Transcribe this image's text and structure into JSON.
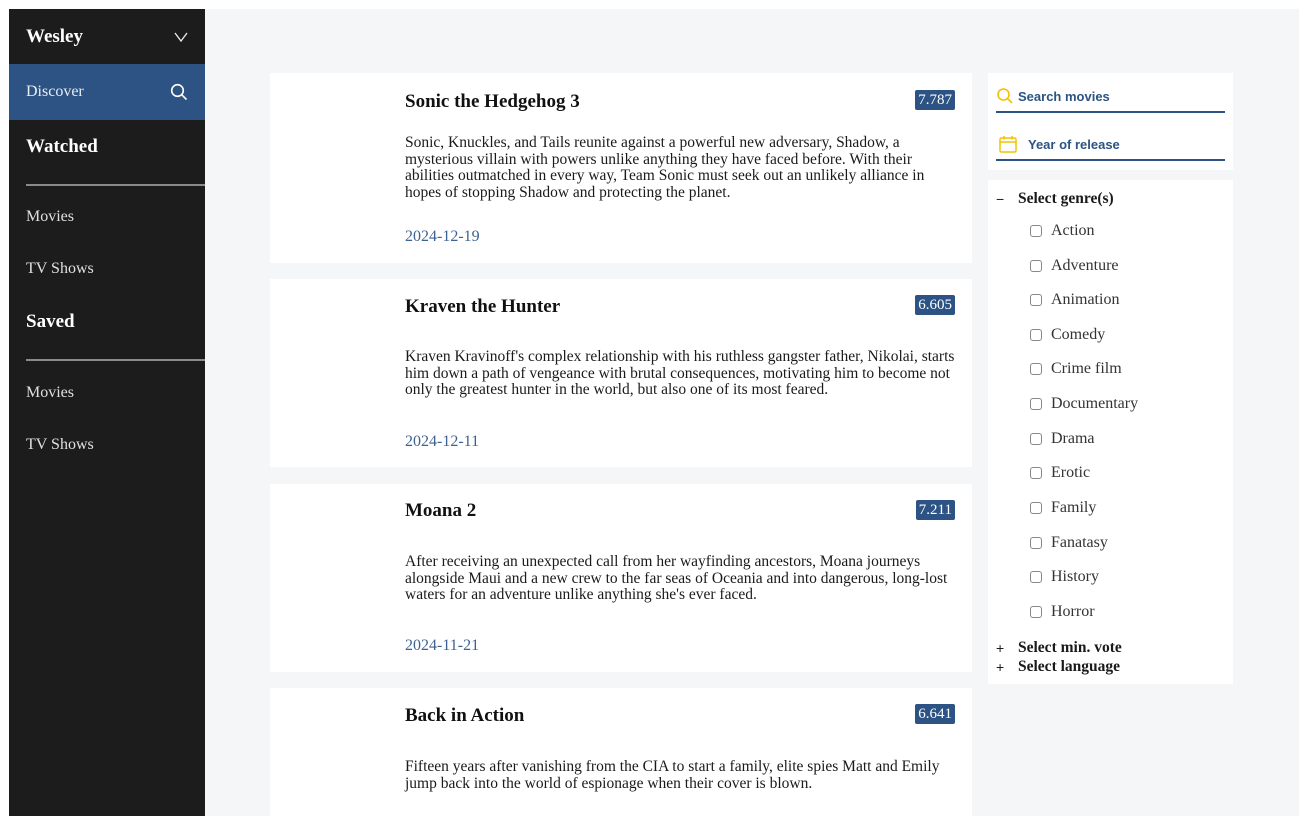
{
  "sidebar": {
    "user_name": "Wesley",
    "discover_label": "Discover",
    "watched": {
      "heading": "Watched",
      "movies": "Movies",
      "tv_shows": "TV Shows"
    },
    "saved": {
      "heading": "Saved",
      "movies": "Movies",
      "tv_shows": "TV Shows"
    }
  },
  "movies": [
    {
      "title": "Sonic the Hedgehog 3",
      "vote": "7.787",
      "overview": "Sonic, Knuckles, and Tails reunite against a powerful new adversary, Shadow, a mysterious villain with powers unlike anything they have faced before. With their abilities outmatched in every way, Team Sonic must seek out an unlikely alliance in hopes of stopping Shadow and protecting the planet.",
      "date": "2024-12-19"
    },
    {
      "title": "Kraven the Hunter",
      "vote": "6.605",
      "overview": "Kraven Kravinoff's complex relationship with his ruthless gangster father, Nikolai, starts him down a path of vengeance with brutal consequences, motivating him to become not only the greatest hunter in the world, but also one of its most feared.",
      "date": "2024-12-11"
    },
    {
      "title": "Moana 2",
      "vote": "7.211",
      "overview": "After receiving an unexpected call from her wayfinding ancestors, Moana journeys alongside Maui and a new crew to the far seas of Oceania and into dangerous, long-lost waters for an adventure unlike anything she's ever faced.",
      "date": "2024-11-21"
    },
    {
      "title": "Back in Action",
      "vote": "6.641",
      "overview": "Fifteen years after vanishing from the CIA to start a family, elite spies Matt and Emily jump back into the world of espionage when their cover is blown.",
      "date": ""
    }
  ],
  "filters": {
    "search_label": "Search movies",
    "year_label": "Year of release",
    "genre_heading": "Select genre(s)",
    "genre_sign": "−",
    "genres": [
      "Action",
      "Adventure",
      "Animation",
      "Comedy",
      "Crime film",
      "Documentary",
      "Drama",
      "Erotic",
      "Family",
      "Fanatasy",
      "History",
      "Horror"
    ],
    "min_vote_heading": "Select min. vote",
    "language_heading": "Select language",
    "collapsed_sign": "+"
  },
  "colors": {
    "sidebar_bg": "#1c1c1c",
    "accent": "#2c5383",
    "search_icon": "#f2c200",
    "date_text": "#3d6291"
  },
  "icons": {
    "user_menu": "chevron-down-icon",
    "discover": "search-icon",
    "search_field": "search-icon",
    "year_field": "calendar-icon"
  }
}
